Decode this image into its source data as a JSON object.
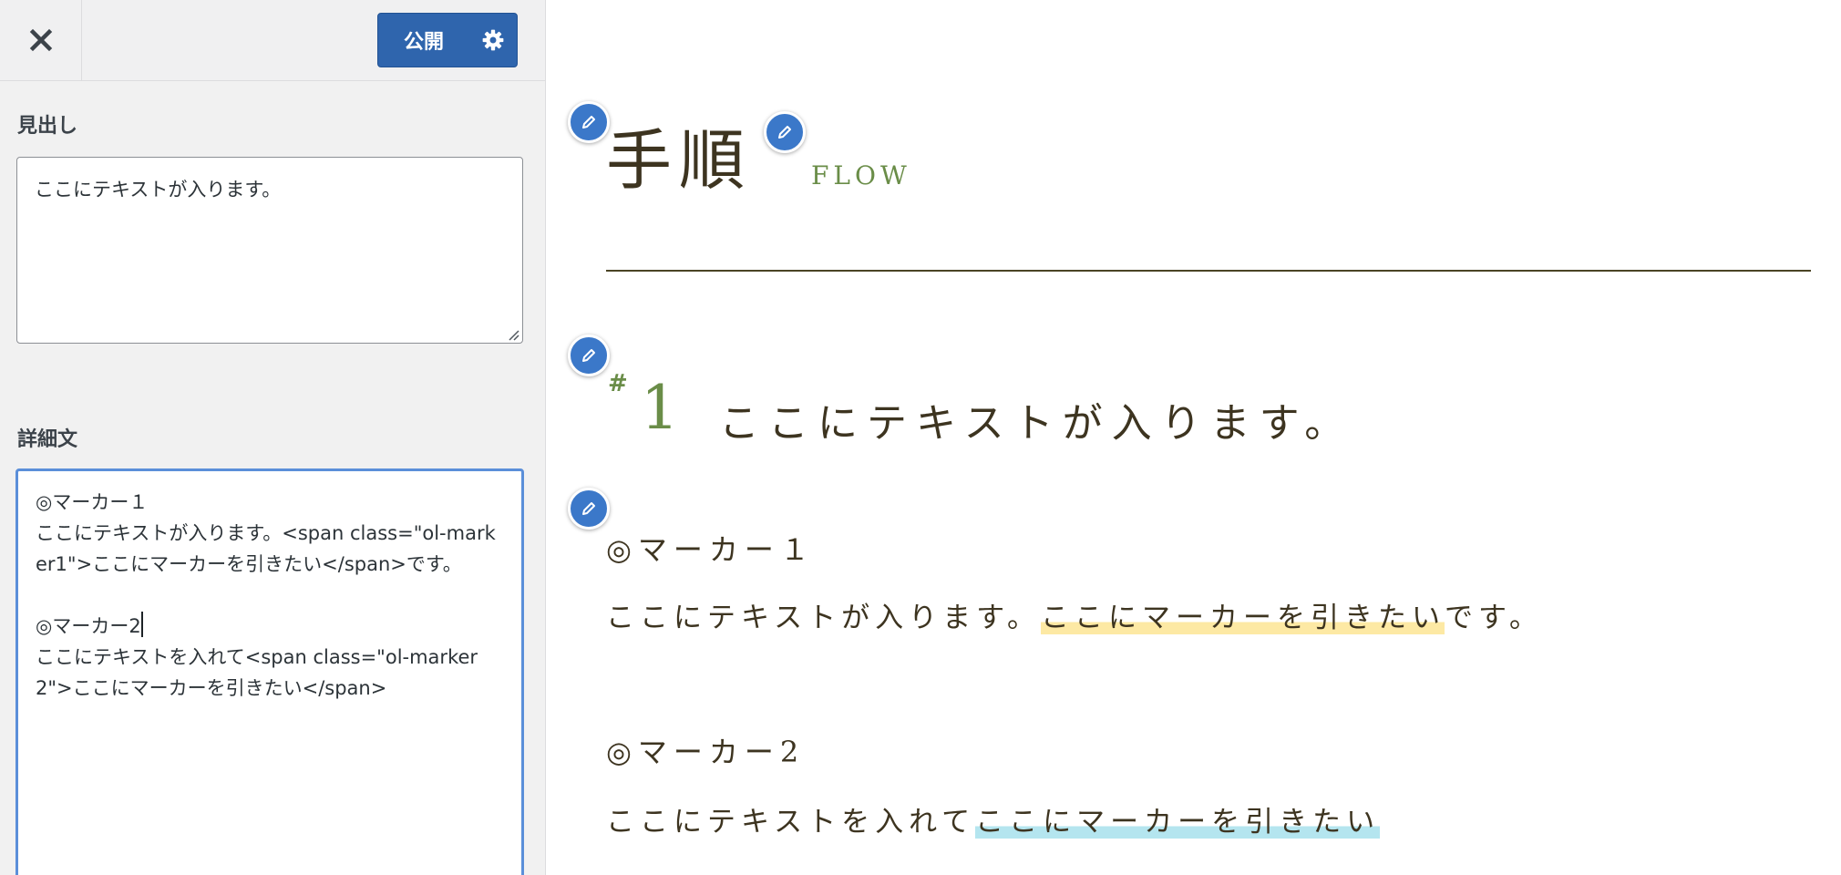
{
  "panel": {
    "publish_label": "公開",
    "heading_label": "見出し",
    "heading_value": "ここにテキストが入ります。",
    "detail_label": "詳細文",
    "detail_lines": [
      "◎マーカー１",
      "ここにテキストが入ります。<span class=\"ol-marker1\">ここにマーカーを引きたい</span>です。",
      "",
      "◎マーカー2",
      "ここにテキストを入れて<span class=\"ol-marker2\">ここにマーカーを引きたい</span>"
    ]
  },
  "preview": {
    "section_title": "手順",
    "section_subtitle": "FLOW",
    "step_hash": "#",
    "step_number": "1",
    "step_heading": "ここにテキストが入ります。",
    "marker1": {
      "heading": "◎マーカー１",
      "text_before": "ここにテキストが入ります。",
      "marked": "ここにマーカーを引きたい",
      "text_after": "です。",
      "color": "#fde9a4"
    },
    "marker2": {
      "heading": "◎マーカー2",
      "text_before": "ここにテキストを入れて",
      "marked": "ここにマーカーを引きたい",
      "color": "#b4e5ef"
    }
  },
  "icons": {
    "close": "close-icon",
    "settings": "gear-icon",
    "edit": "pencil-icon"
  },
  "colors": {
    "publish": "#2f65ad",
    "edit_button": "#3b78c9",
    "accent_green": "#6a8d48",
    "text_brown": "#3d3420",
    "focus_border": "#5b8fd9"
  }
}
